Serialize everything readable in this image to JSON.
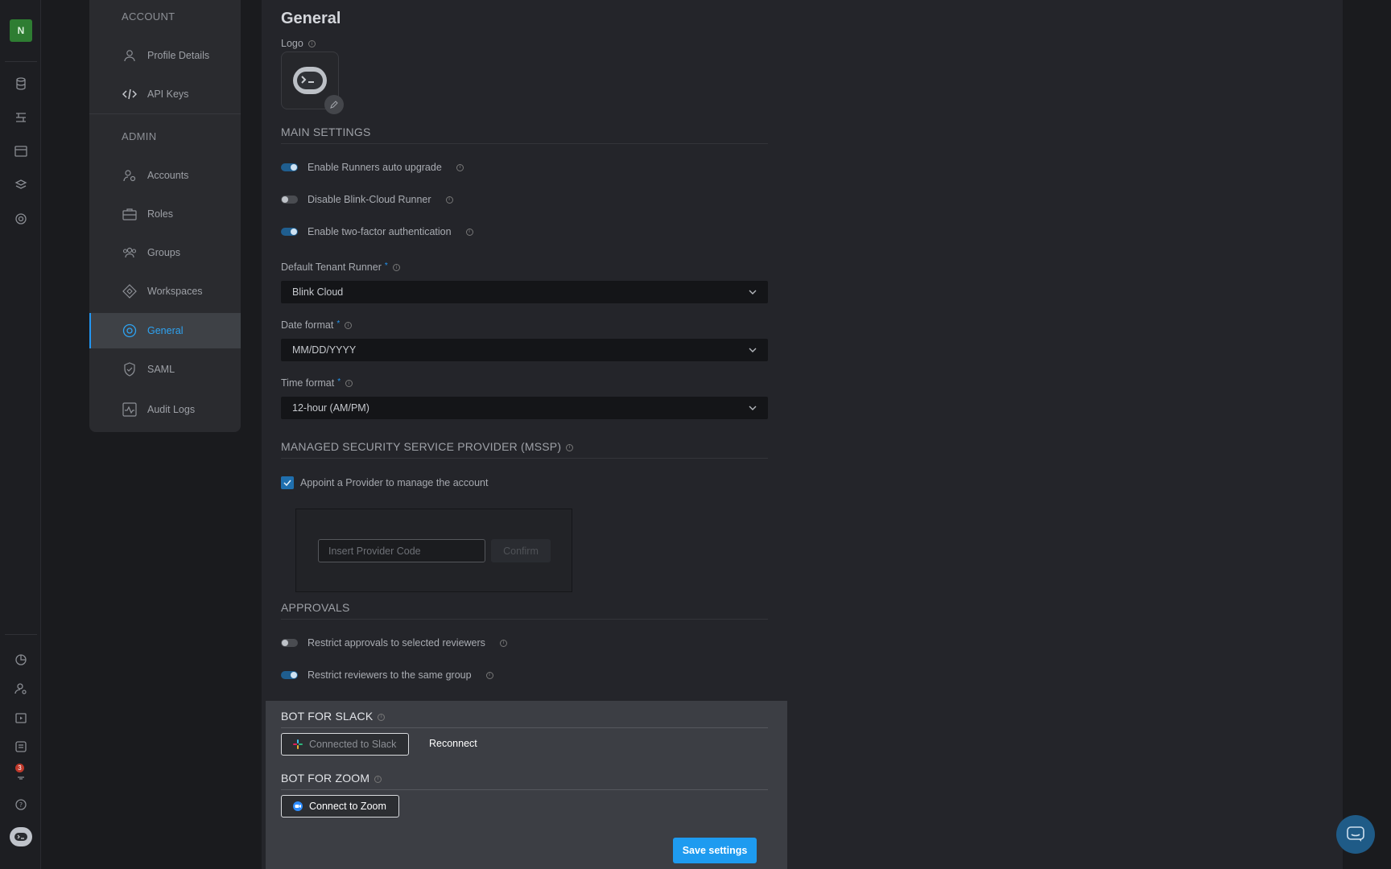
{
  "rail": {
    "workspace_initial": "N",
    "notification_count": "3",
    "top_icons": [
      "database-icon",
      "flow-icon",
      "calendar-icon",
      "layers-icon",
      "settings-circle-icon"
    ],
    "bottom_icons": [
      "pie-chart-icon",
      "user-settings-icon",
      "play-box-icon",
      "library-icon",
      "notification-icon",
      "help-icon",
      "blink-bot-icon"
    ]
  },
  "nav": {
    "account_heading": "ACCOUNT",
    "admin_heading": "ADMIN",
    "account_items": [
      {
        "label": "Profile Details",
        "icon": "user-icon"
      },
      {
        "label": "API Keys",
        "icon": "code-icon"
      }
    ],
    "admin_items": [
      {
        "label": "Accounts",
        "icon": "user-gear-icon"
      },
      {
        "label": "Roles",
        "icon": "briefcase-icon"
      },
      {
        "label": "Groups",
        "icon": "group-icon"
      },
      {
        "label": "Workspaces",
        "icon": "diamond-icon"
      },
      {
        "label": "General",
        "icon": "gear-circle-icon",
        "active": true
      },
      {
        "label": "SAML",
        "icon": "shield-check-icon"
      },
      {
        "label": "Audit Logs",
        "icon": "activity-icon"
      }
    ]
  },
  "page": {
    "title": "General",
    "logo_label": "Logo"
  },
  "main_settings": {
    "heading": "MAIN SETTINGS",
    "toggles": [
      {
        "label": "Enable Runners auto upgrade",
        "on": true
      },
      {
        "label": "Disable Blink-Cloud Runner",
        "on": false
      },
      {
        "label": "Enable two-factor authentication",
        "on": true
      }
    ],
    "default_runner_label": "Default Tenant Runner",
    "default_runner_value": "Blink Cloud",
    "date_format_label": "Date format",
    "date_format_value": "MM/DD/YYYY",
    "time_format_label": "Time format",
    "time_format_value": "12-hour (AM/PM)",
    "required_mark": "*"
  },
  "mssp": {
    "heading": "MANAGED SECURITY SERVICE PROVIDER (MSSP)",
    "checkbox_label": "Appoint a Provider to manage the account",
    "checked": true,
    "input_placeholder": "Insert Provider Code",
    "confirm_label": "Confirm"
  },
  "approvals": {
    "heading": "APPROVALS",
    "toggles": [
      {
        "label": "Restrict approvals to selected reviewers",
        "on": false
      },
      {
        "label": "Restrict reviewers to the same group",
        "on": true
      }
    ]
  },
  "bots": {
    "slack_heading": "BOT FOR SLACK",
    "slack_status": "Connected to Slack",
    "reconnect_label": "Reconnect",
    "zoom_heading": "BOT FOR ZOOM",
    "zoom_button": "Connect to Zoom",
    "save_label": "Save settings"
  },
  "colors": {
    "accent": "#1e9bf0",
    "active_nav": "#2ea3f2",
    "toggle_on": "#1f5e8f"
  }
}
